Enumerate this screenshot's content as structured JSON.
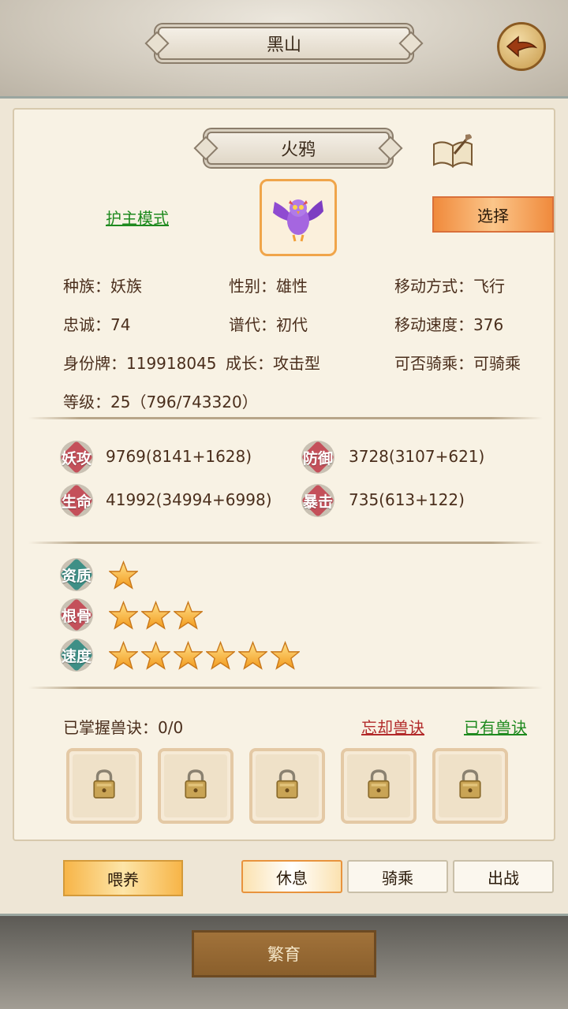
{
  "header": {
    "title": "黑山"
  },
  "pet": {
    "name": "火鸦",
    "mode_link": "护主模式",
    "select_label": "选择"
  },
  "info": {
    "race": "种族：妖族",
    "gender": "性别：雄性",
    "move_type": "移动方式：飞行",
    "loyalty": "忠诚：74",
    "generation": "谱代：初代",
    "move_speed": "移动速度：376",
    "id_tag": "身份牌：119918045",
    "growth": "成长：攻击型",
    "rideable": "可否骑乘：可骑乘",
    "level": "等级：25（796/743320）"
  },
  "stats": [
    {
      "label": "妖攻",
      "value": "9769(8141+1628)",
      "color": "#c4505a"
    },
    {
      "label": "防御",
      "value": "3728(3107+621)",
      "color": "#c4505a"
    },
    {
      "label": "生命",
      "value": "41992(34994+6998)",
      "color": "#c4505a"
    },
    {
      "label": "暴击",
      "value": "735(613+122)",
      "color": "#c4505a"
    }
  ],
  "ratings": [
    {
      "label": "资质",
      "stars": 1,
      "color": "#3e8f86"
    },
    {
      "label": "根骨",
      "stars": 3,
      "color": "#c4505a"
    },
    {
      "label": "速度",
      "stars": 6,
      "color": "#3e8f86"
    }
  ],
  "skills": {
    "title": "已掌握兽诀：0/0",
    "forget_label": "忘却兽诀",
    "owned_label": "已有兽诀",
    "slot_icon": "padlock-icon"
  },
  "actions": {
    "feed": "喂养",
    "rest": "休息",
    "ride": "骑乘",
    "battle": "出战",
    "breed": "繁育"
  }
}
